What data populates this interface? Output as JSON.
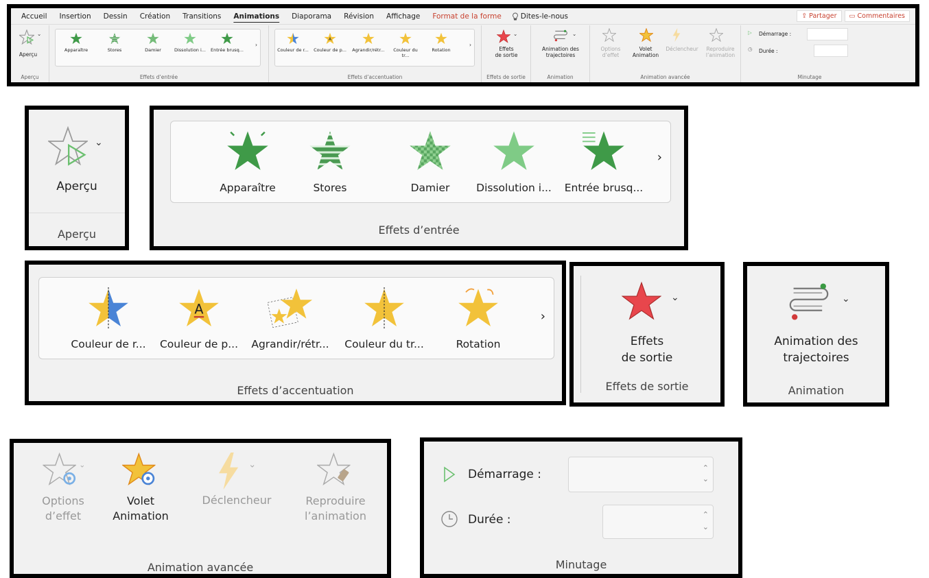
{
  "tabs": [
    "Accueil",
    "Insertion",
    "Dessin",
    "Création",
    "Transitions",
    "Animations",
    "Diaporama",
    "Révision",
    "Affichage",
    "Format de la forme"
  ],
  "tell_me": "Dites-le-nous",
  "share_label": "Partager",
  "comments_label": "Commentaires",
  "preview": {
    "label": "Aperçu",
    "group": "Aperçu"
  },
  "entrance": {
    "group": "Effets d’entrée",
    "items": [
      "Apparaître",
      "Stores",
      "Damier",
      "Dissolution i...",
      "Entrée brusq..."
    ],
    "items_mini": [
      "Apparaître",
      "Stores",
      "Damier",
      "Dissolution i...",
      "Entrée brusq..."
    ]
  },
  "emphasis": {
    "group": "Effets d’accentuation",
    "items": [
      "Couleur de r...",
      "Couleur de p...",
      "Agrandir/rétr...",
      "Couleur du tr...",
      "Rotation"
    ],
    "items_mini": [
      "Couleur de r...",
      "Couleur de p...",
      "Agrandir/rétr...",
      "Couleur du tr...",
      "Rotation"
    ]
  },
  "exit": {
    "line1": "Effets",
    "line2": "de sortie",
    "group": "Effets de sortie"
  },
  "motion": {
    "line1": "Animation des",
    "line2": "trajectoires",
    "group": "Animation"
  },
  "advanced": {
    "group": "Animation avancée",
    "options": {
      "line1": "Options",
      "line2": "d’effet"
    },
    "pane": {
      "line1": "Volet",
      "line2": "Animation"
    },
    "trigger": {
      "line1": "Déclencheur"
    },
    "painter": {
      "line1": "Reproduire",
      "line2": "l’animation"
    }
  },
  "timing": {
    "group": "Minutage",
    "start_label": "Démarrage :",
    "duration_label": "Durée :",
    "start_value": "",
    "duration_value": ""
  },
  "colors": {
    "green": "#3f9a48",
    "gold": "#f2c23a",
    "exit_red": "#e8464c",
    "accent": "#c8412f"
  }
}
